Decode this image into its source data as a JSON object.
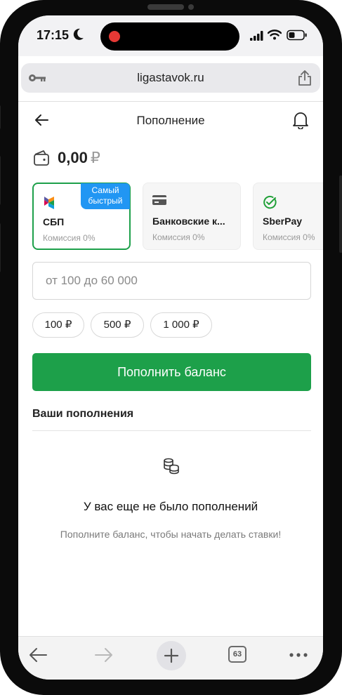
{
  "status_bar": {
    "time": "17:15"
  },
  "browser": {
    "url": "ligastavok.ru",
    "tabs_count": "63"
  },
  "header": {
    "title": "Пополнение"
  },
  "balance": {
    "amount": "0,00",
    "currency": "₽"
  },
  "payment_methods": [
    {
      "name": "СБП",
      "fee": "Комиссия 0%",
      "badge": "Самый быстрый",
      "selected": true,
      "icon": "sbp-icon"
    },
    {
      "name": "Банковские к...",
      "fee": "Комиссия 0%",
      "selected": false,
      "icon": "card-icon"
    },
    {
      "name": "SberPay",
      "fee": "Комиссия 0%",
      "selected": false,
      "icon": "sberpay-icon"
    }
  ],
  "amount_input": {
    "placeholder": "от 100 до 60 000",
    "value": ""
  },
  "quick_amounts": [
    "100 ₽",
    "500 ₽",
    "1 000 ₽"
  ],
  "submit_label": "Пополнить баланс",
  "deposits": {
    "section_title": "Ваши пополнения",
    "empty_title": "У вас еще не было пополнений",
    "empty_subtitle": "Пополните баланс, чтобы начать делать ставки!"
  },
  "colors": {
    "accent": "#1da04a",
    "badge": "#2196f3",
    "muted": "#9a9a9a"
  }
}
